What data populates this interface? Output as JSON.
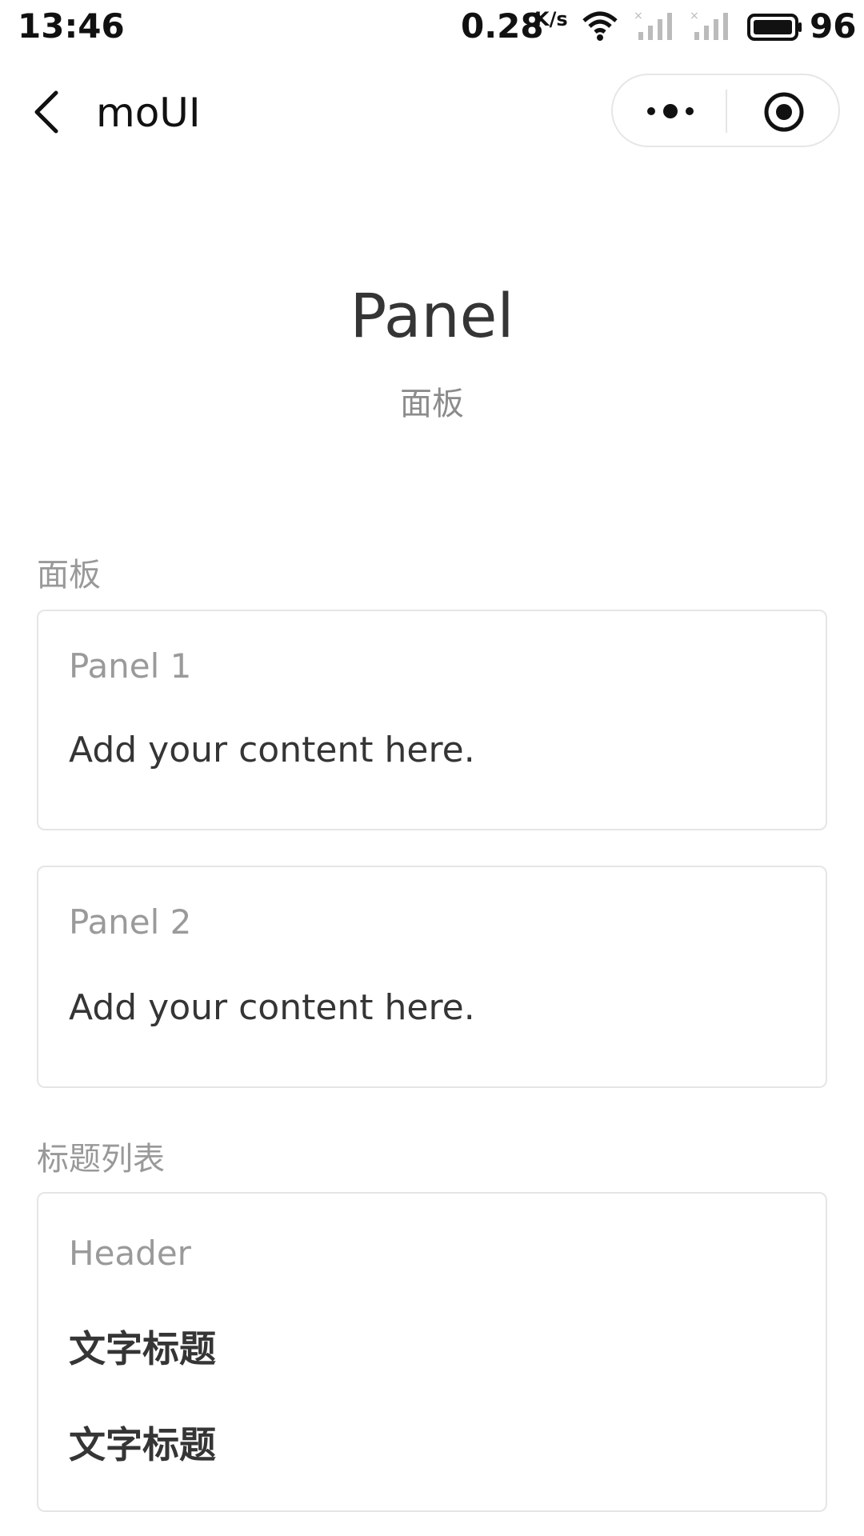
{
  "status_bar": {
    "time": "13:46",
    "network_speed": "0.28",
    "network_speed_unit": "K/s",
    "battery": "96"
  },
  "nav": {
    "title": "moUI"
  },
  "header": {
    "title": "Panel",
    "subtitle": "面板"
  },
  "sections": {
    "panels_title": "面板",
    "panels": [
      {
        "head": "Panel 1",
        "body": "Add your content here."
      },
      {
        "head": "Panel 2",
        "body": "Add your content here."
      }
    ],
    "list_title": "标题列表",
    "list_panel": {
      "head": "Header",
      "items": [
        "文字标题",
        "文字标题"
      ]
    }
  }
}
